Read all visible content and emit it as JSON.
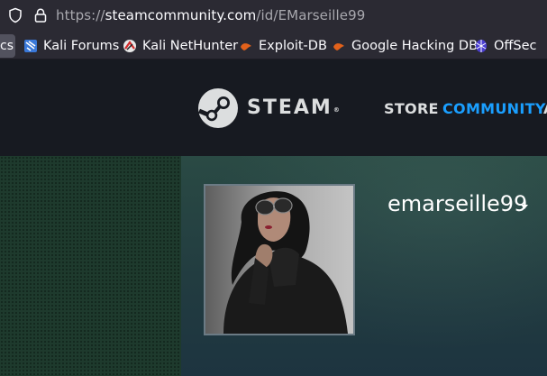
{
  "browser": {
    "url": {
      "protocol": "https://",
      "host": "steamcommunity.com",
      "path": "/id/EMarseille99"
    },
    "icons": [
      "shield-icon",
      "lock-icon"
    ]
  },
  "bookmarks": {
    "truncated_label": "cs",
    "items": [
      {
        "label": "Kali Forums",
        "icon": "kali-forums-icon"
      },
      {
        "label": "Kali NetHunter",
        "icon": "kali-nethunter-icon"
      },
      {
        "label": "Exploit-DB",
        "icon": "exploit-db-icon"
      },
      {
        "label": "Google Hacking DB",
        "icon": "google-hacking-db-icon"
      },
      {
        "label": "OffSec",
        "icon": "offsec-icon"
      }
    ]
  },
  "steam": {
    "brand": "STEAM",
    "trademark": "®",
    "nav": {
      "store": "STORE",
      "community": "COMMUNITY",
      "more": "A"
    },
    "colors": {
      "header_bg": "#171a21",
      "nav_active": "#1a9fff",
      "nav_text": "#dcdedf"
    }
  },
  "profile": {
    "username": "emarseille99",
    "avatar": "profile-avatar-photo"
  }
}
